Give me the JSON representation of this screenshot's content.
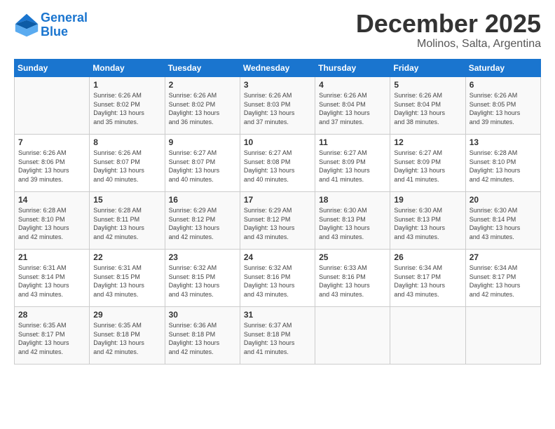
{
  "header": {
    "logo_line1": "General",
    "logo_line2": "Blue",
    "month": "December 2025",
    "location": "Molinos, Salta, Argentina"
  },
  "weekdays": [
    "Sunday",
    "Monday",
    "Tuesday",
    "Wednesday",
    "Thursday",
    "Friday",
    "Saturday"
  ],
  "weeks": [
    [
      {
        "day": "",
        "info": ""
      },
      {
        "day": "1",
        "info": "Sunrise: 6:26 AM\nSunset: 8:02 PM\nDaylight: 13 hours\nand 35 minutes."
      },
      {
        "day": "2",
        "info": "Sunrise: 6:26 AM\nSunset: 8:02 PM\nDaylight: 13 hours\nand 36 minutes."
      },
      {
        "day": "3",
        "info": "Sunrise: 6:26 AM\nSunset: 8:03 PM\nDaylight: 13 hours\nand 37 minutes."
      },
      {
        "day": "4",
        "info": "Sunrise: 6:26 AM\nSunset: 8:04 PM\nDaylight: 13 hours\nand 37 minutes."
      },
      {
        "day": "5",
        "info": "Sunrise: 6:26 AM\nSunset: 8:04 PM\nDaylight: 13 hours\nand 38 minutes."
      },
      {
        "day": "6",
        "info": "Sunrise: 6:26 AM\nSunset: 8:05 PM\nDaylight: 13 hours\nand 39 minutes."
      }
    ],
    [
      {
        "day": "7",
        "info": "Sunrise: 6:26 AM\nSunset: 8:06 PM\nDaylight: 13 hours\nand 39 minutes."
      },
      {
        "day": "8",
        "info": "Sunrise: 6:26 AM\nSunset: 8:07 PM\nDaylight: 13 hours\nand 40 minutes."
      },
      {
        "day": "9",
        "info": "Sunrise: 6:27 AM\nSunset: 8:07 PM\nDaylight: 13 hours\nand 40 minutes."
      },
      {
        "day": "10",
        "info": "Sunrise: 6:27 AM\nSunset: 8:08 PM\nDaylight: 13 hours\nand 40 minutes."
      },
      {
        "day": "11",
        "info": "Sunrise: 6:27 AM\nSunset: 8:09 PM\nDaylight: 13 hours\nand 41 minutes."
      },
      {
        "day": "12",
        "info": "Sunrise: 6:27 AM\nSunset: 8:09 PM\nDaylight: 13 hours\nand 41 minutes."
      },
      {
        "day": "13",
        "info": "Sunrise: 6:28 AM\nSunset: 8:10 PM\nDaylight: 13 hours\nand 42 minutes."
      }
    ],
    [
      {
        "day": "14",
        "info": "Sunrise: 6:28 AM\nSunset: 8:10 PM\nDaylight: 13 hours\nand 42 minutes."
      },
      {
        "day": "15",
        "info": "Sunrise: 6:28 AM\nSunset: 8:11 PM\nDaylight: 13 hours\nand 42 minutes."
      },
      {
        "day": "16",
        "info": "Sunrise: 6:29 AM\nSunset: 8:12 PM\nDaylight: 13 hours\nand 42 minutes."
      },
      {
        "day": "17",
        "info": "Sunrise: 6:29 AM\nSunset: 8:12 PM\nDaylight: 13 hours\nand 43 minutes."
      },
      {
        "day": "18",
        "info": "Sunrise: 6:30 AM\nSunset: 8:13 PM\nDaylight: 13 hours\nand 43 minutes."
      },
      {
        "day": "19",
        "info": "Sunrise: 6:30 AM\nSunset: 8:13 PM\nDaylight: 13 hours\nand 43 minutes."
      },
      {
        "day": "20",
        "info": "Sunrise: 6:30 AM\nSunset: 8:14 PM\nDaylight: 13 hours\nand 43 minutes."
      }
    ],
    [
      {
        "day": "21",
        "info": "Sunrise: 6:31 AM\nSunset: 8:14 PM\nDaylight: 13 hours\nand 43 minutes."
      },
      {
        "day": "22",
        "info": "Sunrise: 6:31 AM\nSunset: 8:15 PM\nDaylight: 13 hours\nand 43 minutes."
      },
      {
        "day": "23",
        "info": "Sunrise: 6:32 AM\nSunset: 8:15 PM\nDaylight: 13 hours\nand 43 minutes."
      },
      {
        "day": "24",
        "info": "Sunrise: 6:32 AM\nSunset: 8:16 PM\nDaylight: 13 hours\nand 43 minutes."
      },
      {
        "day": "25",
        "info": "Sunrise: 6:33 AM\nSunset: 8:16 PM\nDaylight: 13 hours\nand 43 minutes."
      },
      {
        "day": "26",
        "info": "Sunrise: 6:34 AM\nSunset: 8:17 PM\nDaylight: 13 hours\nand 43 minutes."
      },
      {
        "day": "27",
        "info": "Sunrise: 6:34 AM\nSunset: 8:17 PM\nDaylight: 13 hours\nand 42 minutes."
      }
    ],
    [
      {
        "day": "28",
        "info": "Sunrise: 6:35 AM\nSunset: 8:17 PM\nDaylight: 13 hours\nand 42 minutes."
      },
      {
        "day": "29",
        "info": "Sunrise: 6:35 AM\nSunset: 8:18 PM\nDaylight: 13 hours\nand 42 minutes."
      },
      {
        "day": "30",
        "info": "Sunrise: 6:36 AM\nSunset: 8:18 PM\nDaylight: 13 hours\nand 42 minutes."
      },
      {
        "day": "31",
        "info": "Sunrise: 6:37 AM\nSunset: 8:18 PM\nDaylight: 13 hours\nand 41 minutes."
      },
      {
        "day": "",
        "info": ""
      },
      {
        "day": "",
        "info": ""
      },
      {
        "day": "",
        "info": ""
      }
    ]
  ]
}
